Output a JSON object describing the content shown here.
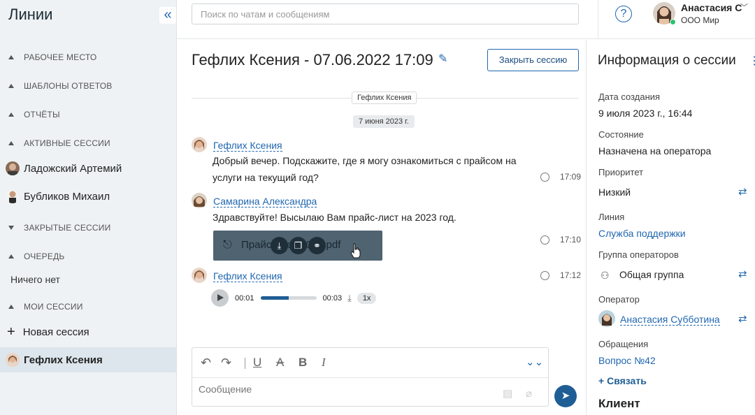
{
  "sidebar": {
    "title": "Линии",
    "sections": {
      "workplace": "РАБОЧЕЕ МЕСТО",
      "templates": "ШАБЛОНЫ ОТВЕТОВ",
      "reports": "ОТЧЁТЫ",
      "active": "АКТИВНЫЕ СЕССИИ",
      "closed": "ЗАКРЫТЫЕ СЕССИИ",
      "queue": "ОЧЕРЕДЬ",
      "mine": "МОИ СЕССИИ"
    },
    "active_items": [
      "Ладожский Артемий",
      "Бубликов Михаил"
    ],
    "queue_empty": "Ничего нет",
    "new_session": "Новая сессия",
    "current_session": "Гефлих Ксения"
  },
  "header": {
    "search_placeholder": "Поиск по чатам и сообщениям",
    "user_name": "Анастасия С",
    "user_company": "ООО Мир"
  },
  "chat": {
    "title": "Гефлих Ксения - 07.06.2022 17:09",
    "close_button": "Закрыть сессию",
    "divider_label": "Гефлих Ксения",
    "date_label": "7 июня 2023 г.",
    "messages": [
      {
        "author": "Гефлих Ксения",
        "text": "Добрый вечер. Подскажите, где я могу ознакомиться с прайсом на услуги на текущий год?",
        "time": "17:09"
      },
      {
        "author": "Самарина Александра",
        "text": "Здравствуйте! Высылаю Вам прайс-лист на 2023 год.",
        "time": "17:10",
        "file_name": "Прайс-лист 2024.pdf"
      },
      {
        "author": "Гефлих Ксения",
        "time": "17:12",
        "audio": {
          "current": "00:01",
          "total": "00:03",
          "progress": 0.5,
          "rate": "1x"
        }
      }
    ],
    "composer_placeholder": "Сообщение"
  },
  "session_info": {
    "title": "Информация о сессии",
    "created_label": "Дата создания",
    "created_value": "9 июля 2023 г., 16:44",
    "state_label": "Состояние",
    "state_value": "Назначена на оператора",
    "priority_label": "Приоритет",
    "priority_value": "Низкий",
    "line_label": "Линия",
    "line_value": "Служба поддержки",
    "group_label": "Группа операторов",
    "group_value": "Общая группа",
    "operator_label": "Оператор",
    "operator_value": "Анастасия Субботина",
    "requests_label": "Обращения",
    "requests_value": "Вопрос №42",
    "bind_label": "Связать",
    "client_label": "Клиент"
  },
  "colors": {
    "accent": "#2067b0",
    "sidebar_bg": "#eef2f4",
    "send": "#1f5e95"
  }
}
